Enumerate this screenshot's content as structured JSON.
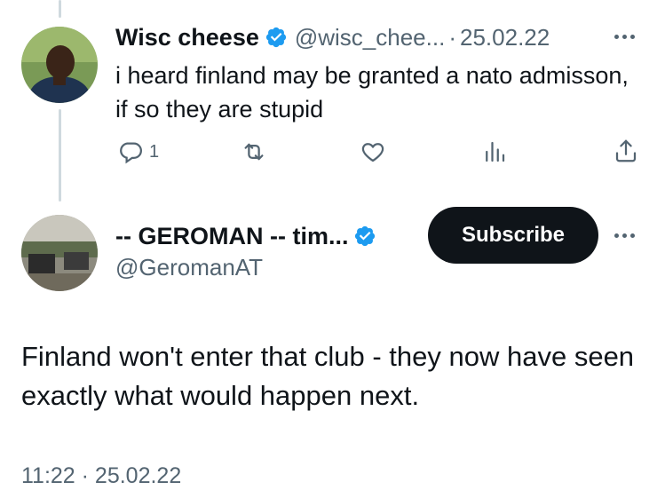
{
  "colors": {
    "text": "#0f1419",
    "secondary": "#536471",
    "verified": "#1d9bf0",
    "button": "#0f1419"
  },
  "reply_tweet": {
    "author_name": "Wisc cheese",
    "handle": "@wisc_chee...",
    "separator": "·",
    "date": "25.02.22",
    "text": "i heard finland may be granted a nato admisson, if so they are stupid",
    "reply_count": "1",
    "icons": [
      "reply-icon",
      "retweet-icon",
      "like-icon",
      "views-icon",
      "share-icon"
    ]
  },
  "main_tweet": {
    "author_name": "-- GEROMAN -- tim...",
    "handle": "@GeromanAT",
    "subscribe_label": "Subscribe",
    "text": "Finland won't enter that club - they now have seen exactly what would happen next.",
    "timestamp": "11:22 · 25.02.22"
  }
}
